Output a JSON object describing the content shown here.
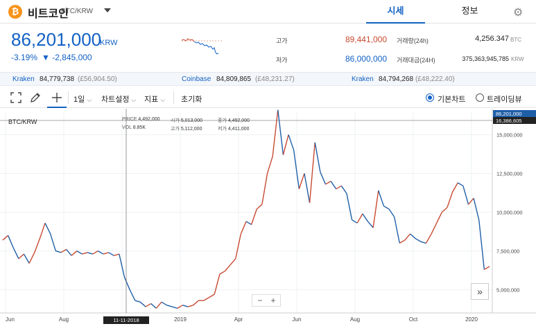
{
  "header": {
    "coin_icon": "bitcoin-icon",
    "coin_name": "비트코인",
    "pair": "BTC/KRW",
    "tabs": [
      {
        "label": "시세",
        "active": true
      },
      {
        "label": "정보",
        "active": false
      }
    ],
    "settings_icon": "gear-icon"
  },
  "price": {
    "value": "86,201,000",
    "currency": "KRW",
    "change_pct": "-3.19%",
    "change_abs": "▼ -2,845,000"
  },
  "stats": {
    "high_label": "고가",
    "high_value": "89,441,000",
    "low_label": "저가",
    "low_value": "86,000,000",
    "volume_label": "거래량(24h)",
    "volume_value": "4,256.347",
    "volume_unit": "BTC",
    "amount_label": "거래대금(24H)",
    "amount_value": "375,363,945,785",
    "amount_unit": "KRW"
  },
  "exchanges": [
    {
      "name": "Kraken",
      "value": "84,779,738",
      "gbp": "(£56,904.50)"
    },
    {
      "name": "Coinbase",
      "value": "84,809,865",
      "gbp": "(£48,231.27)"
    },
    {
      "name": "Kraken",
      "value": "84,794,268",
      "gbp": "(£48,222.40)"
    }
  ],
  "toolbar": {
    "fullscreen_icon": "fullscreen-icon",
    "draw_icon": "pencil-icon",
    "crosshair_icon": "crosshair-icon",
    "interval": "1일",
    "chart_settings": "차트설정",
    "indicators": "지표",
    "reset": "초기화",
    "basic_chart": "기본차트",
    "tradingview": "트레이딩뷰"
  },
  "chart_data": {
    "type": "line",
    "title": "BTC/KRW",
    "x_labels": [
      "Jun",
      "Aug",
      "Oct",
      "2019",
      "Apr",
      "Jun",
      "Aug",
      "Oct",
      "2020"
    ],
    "crosshair_date": "11-11-2018",
    "y_ticks": [
      "15,000,000",
      "12,500,000",
      "10,000,000",
      "7,500,000",
      "5,000,000"
    ],
    "ylim": [
      3500000,
      16500000
    ],
    "current_price_tag": "86,201,000",
    "crosshair_price_tag": "16,386,605",
    "info": {
      "price_label": "PRICE",
      "price": "4,492,000",
      "vol_label": "VOL",
      "vol": "8.85K",
      "open_label": "시가",
      "open": "5,013,000",
      "high_label": "고가",
      "high": "5,112,000",
      "close_label": "종가",
      "close": "4,492,000",
      "low_label": "저가",
      "low": "4,411,000"
    },
    "series": [
      {
        "values": [
          8200000,
          8500000,
          7700000,
          7000000,
          7300000,
          6700000,
          7400000,
          8300000,
          9300000,
          8600000,
          7500000,
          7400000,
          7600000,
          7200000,
          7500000,
          7300000,
          7400000,
          7300000,
          7500000,
          7300000,
          7400000,
          7200000,
          7300000,
          5800000,
          5000000,
          4300000,
          4200000,
          3900000,
          4100000,
          3800000,
          4200000,
          4000000,
          3900000,
          3800000,
          4000000,
          3900000,
          4000000,
          4300000,
          4300000,
          4500000,
          4700000,
          6000000,
          6200000,
          6600000,
          7000000,
          8600000,
          9400000,
          9200000,
          10200000,
          10500000,
          12500000,
          13600000,
          16600000,
          13700000,
          15000000,
          14000000,
          11500000,
          12500000,
          10600000,
          14500000,
          12600000,
          11800000,
          12000000,
          11500000,
          11700000,
          11200000,
          9500000,
          9300000,
          9900000,
          9400000,
          9000000,
          11400000,
          10400000,
          10200000,
          9700000,
          8000000,
          8200000,
          8600000,
          8300000,
          8100000,
          8000000,
          8600000,
          9300000,
          10000000,
          10300000,
          11300000,
          11900000,
          11700000,
          10500000,
          10900000,
          9500000,
          6300000,
          6500000
        ],
        "colors": {
          "up": "#c84a31",
          "down": "#1f5fa8"
        }
      }
    ],
    "grid": true
  }
}
